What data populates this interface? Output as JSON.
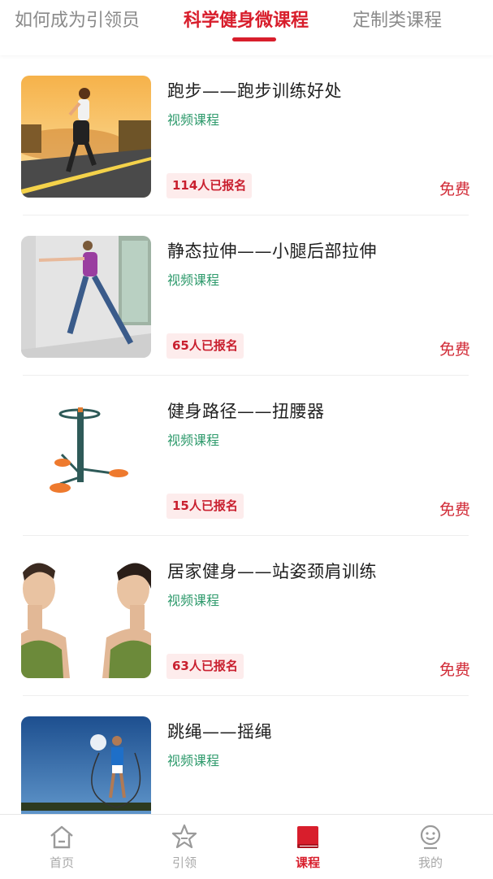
{
  "top_tabs": [
    {
      "label": "如何成为引领员",
      "active": false
    },
    {
      "label": "科学健身微课程",
      "active": true
    },
    {
      "label": "定制类课程",
      "active": false
    }
  ],
  "courses": [
    {
      "title": "跑步——跑步训练好处",
      "subtitle": "视频课程",
      "enrolled": "114人已报名",
      "price": "免费",
      "thumb": "runner-photo"
    },
    {
      "title": "静态拉伸——小腿后部拉伸",
      "subtitle": "视频课程",
      "enrolled": "65人已报名",
      "price": "免费",
      "thumb": "calf-stretch-photo"
    },
    {
      "title": "健身路径——扭腰器",
      "subtitle": "视频课程",
      "enrolled": "15人已报名",
      "price": "免费",
      "thumb": "waist-twister-photo"
    },
    {
      "title": "居家健身——站姿颈肩训练",
      "subtitle": "视频课程",
      "enrolled": "63人已报名",
      "price": "免费",
      "thumb": "neck-shoulder-photo"
    },
    {
      "title": "跳绳——摇绳",
      "subtitle": "视频课程",
      "enrolled": "",
      "price": "",
      "thumb": "jump-rope-photo"
    }
  ],
  "bottom_nav": [
    {
      "label": "首页",
      "icon": "home-icon",
      "active": false
    },
    {
      "label": "引领",
      "icon": "star-icon",
      "active": false
    },
    {
      "label": "课程",
      "icon": "book-icon",
      "active": true
    },
    {
      "label": "我的",
      "icon": "profile-icon",
      "active": false
    }
  ],
  "colors": {
    "accent": "#d81e2c",
    "subtitle_green": "#2e9a6c",
    "badge_bg": "#fdecec"
  }
}
